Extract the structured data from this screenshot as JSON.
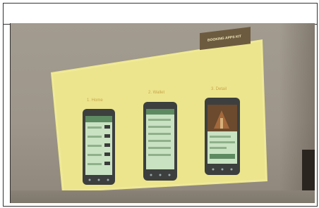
{
  "photo": {
    "subject": "projected slide of three mobile app screens",
    "colors": {
      "wall": "#a29b8f",
      "slide": "#ece58e",
      "badge": "#6d5b40",
      "phone": "#3c3f3e",
      "phone_screen": "#c9e2c2"
    },
    "slide": {
      "badge_text": "BOOKING APPS KIT",
      "labels": [
        "1. Home",
        "2. Wallet",
        "3. Detail"
      ]
    }
  }
}
